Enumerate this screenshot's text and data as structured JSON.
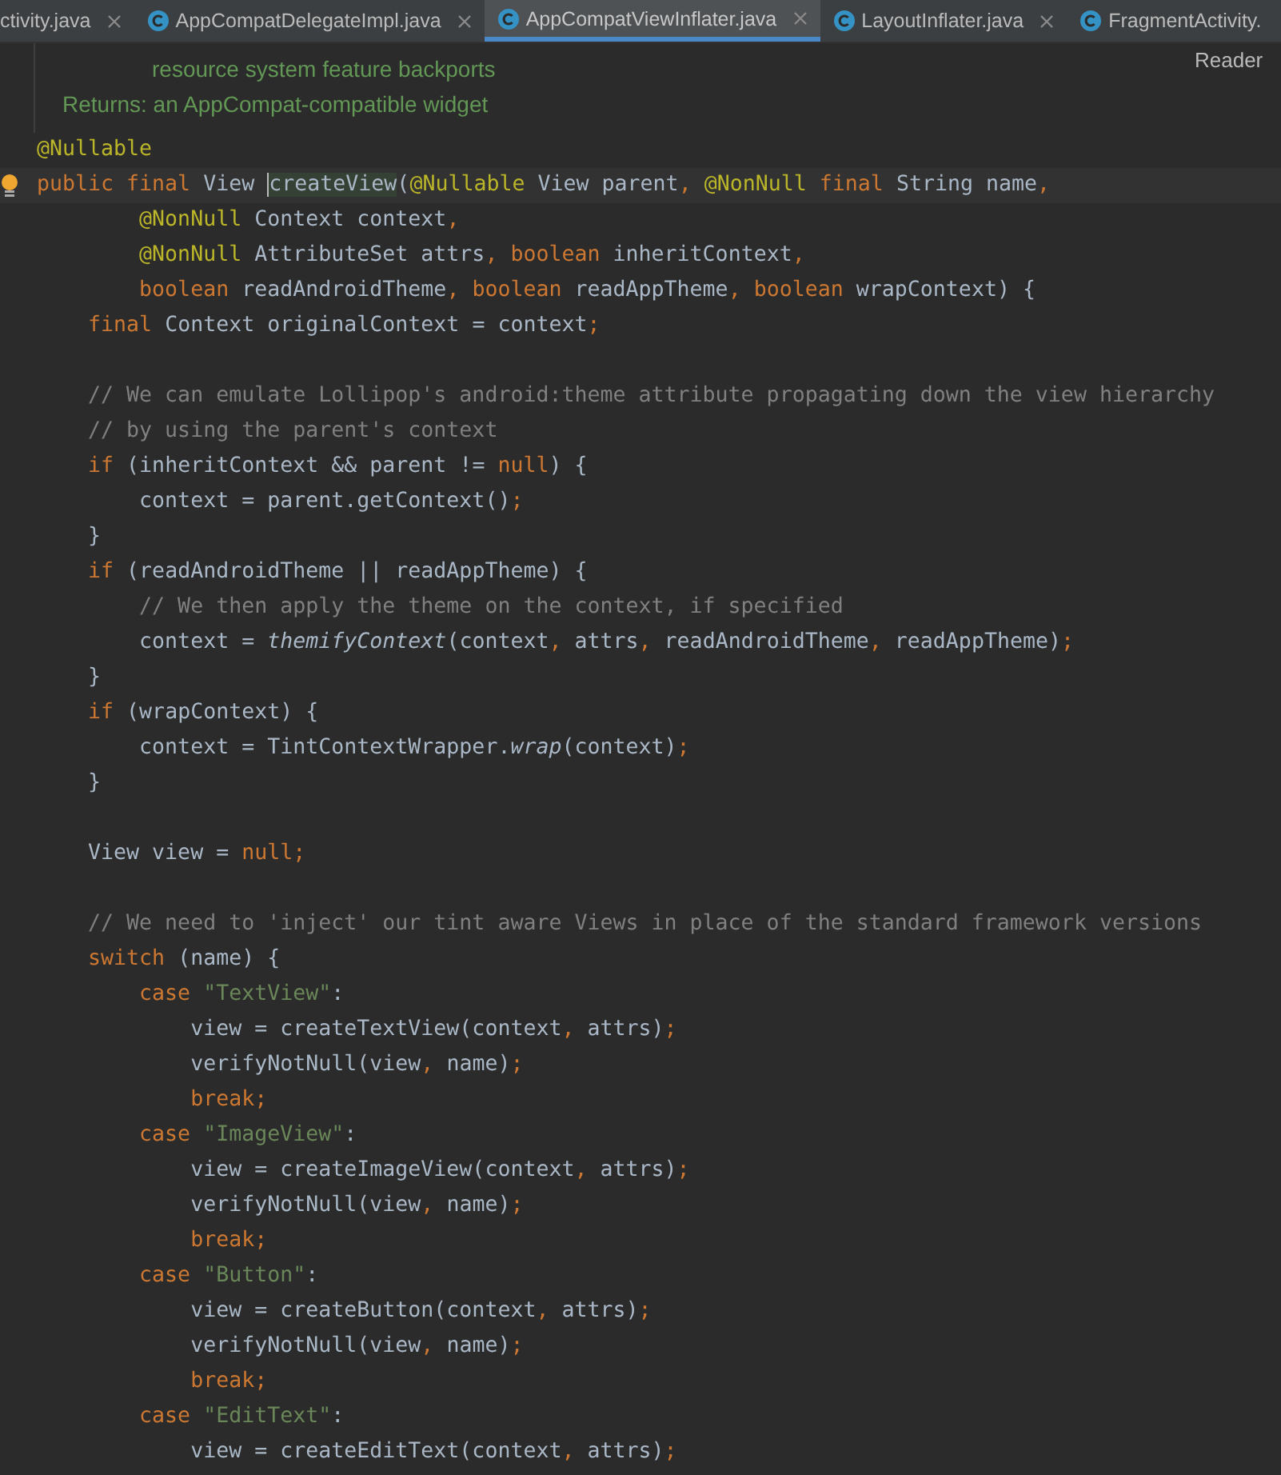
{
  "tabs": [
    {
      "label": "ctivity.java",
      "icon": false,
      "selected": false
    },
    {
      "label": "AppCompatDelegateImpl.java",
      "icon": true,
      "selected": false
    },
    {
      "label": "AppCompatViewInflater.java",
      "icon": true,
      "selected": true
    },
    {
      "label": "LayoutInflater.java",
      "icon": true,
      "selected": false
    },
    {
      "label": "FragmentActivity.",
      "icon": true,
      "selected": false
    }
  ],
  "doc": {
    "lines": [
      "resource system feature backports"
    ],
    "returns": "Returns: an AppCompat-compatible widget",
    "reader_mode": "Reader"
  },
  "code": [
    {
      "kind": "code",
      "tokens": [
        {
          "kind": "ann",
          "text": "@Nullable"
        }
      ]
    },
    {
      "kind": "code",
      "current": true,
      "bulb": true,
      "tokens": [
        {
          "kind": "kw",
          "text": "public final "
        },
        {
          "kind": "id",
          "text": "View "
        },
        {
          "kind": "hl",
          "text": "createView"
        },
        {
          "kind": "id",
          "text": "("
        },
        {
          "kind": "ann",
          "text": "@Nullable "
        },
        {
          "kind": "id",
          "text": "View parent"
        },
        {
          "kind": "kw",
          "text": ", "
        },
        {
          "kind": "ann",
          "text": "@NonNull "
        },
        {
          "kind": "kw",
          "text": "final "
        },
        {
          "kind": "id",
          "text": "String name"
        },
        {
          "kind": "kw",
          "text": ","
        }
      ]
    },
    {
      "kind": "code",
      "tokens": [
        {
          "kind": "ann",
          "text": "        @NonNull "
        },
        {
          "kind": "id",
          "text": "Context context"
        },
        {
          "kind": "kw",
          "text": ","
        }
      ]
    },
    {
      "kind": "code",
      "tokens": [
        {
          "kind": "ann",
          "text": "        @NonNull "
        },
        {
          "kind": "id",
          "text": "AttributeSet attrs"
        },
        {
          "kind": "kw",
          "text": ", boolean "
        },
        {
          "kind": "id",
          "text": "inheritContext"
        },
        {
          "kind": "kw",
          "text": ","
        }
      ]
    },
    {
      "kind": "code",
      "tokens": [
        {
          "kind": "kw",
          "text": "        boolean "
        },
        {
          "kind": "id",
          "text": "readAndroidTheme"
        },
        {
          "kind": "kw",
          "text": ", boolean "
        },
        {
          "kind": "id",
          "text": "readAppTheme"
        },
        {
          "kind": "kw",
          "text": ", boolean "
        },
        {
          "kind": "id",
          "text": "wrapContext) {"
        }
      ]
    },
    {
      "kind": "code",
      "tokens": [
        {
          "kind": "kw",
          "text": "    final "
        },
        {
          "kind": "id",
          "text": "Context originalContext = context"
        },
        {
          "kind": "kw",
          "text": ";"
        }
      ]
    },
    {
      "kind": "blank"
    },
    {
      "kind": "code",
      "tokens": [
        {
          "kind": "cm",
          "text": "    // We can emulate Lollipop's android:theme attribute propagating down the view hierarchy"
        }
      ]
    },
    {
      "kind": "code",
      "tokens": [
        {
          "kind": "cm",
          "text": "    // by using the parent's context"
        }
      ]
    },
    {
      "kind": "code",
      "tokens": [
        {
          "kind": "kw",
          "text": "    if "
        },
        {
          "kind": "id",
          "text": "(inheritContext && parent != "
        },
        {
          "kind": "kw",
          "text": "null"
        },
        {
          "kind": "id",
          "text": ") {"
        }
      ]
    },
    {
      "kind": "code",
      "tokens": [
        {
          "kind": "id",
          "text": "        context = parent.getContext()"
        },
        {
          "kind": "kw",
          "text": ";"
        }
      ]
    },
    {
      "kind": "code",
      "tokens": [
        {
          "kind": "id",
          "text": "    }"
        }
      ]
    },
    {
      "kind": "code",
      "tokens": [
        {
          "kind": "kw",
          "text": "    if "
        },
        {
          "kind": "id",
          "text": "(readAndroidTheme || readAppTheme) {"
        }
      ]
    },
    {
      "kind": "code",
      "tokens": [
        {
          "kind": "cm",
          "text": "        // We then apply the theme on the context, if specified"
        }
      ]
    },
    {
      "kind": "code",
      "tokens": [
        {
          "kind": "id",
          "text": "        context = "
        },
        {
          "kind": "it",
          "text": "themifyContext"
        },
        {
          "kind": "id",
          "text": "(context"
        },
        {
          "kind": "kw",
          "text": ", "
        },
        {
          "kind": "id",
          "text": "attrs"
        },
        {
          "kind": "kw",
          "text": ", "
        },
        {
          "kind": "id",
          "text": "readAndroidTheme"
        },
        {
          "kind": "kw",
          "text": ", "
        },
        {
          "kind": "id",
          "text": "readAppTheme)"
        },
        {
          "kind": "kw",
          "text": ";"
        }
      ]
    },
    {
      "kind": "code",
      "tokens": [
        {
          "kind": "id",
          "text": "    }"
        }
      ]
    },
    {
      "kind": "code",
      "tokens": [
        {
          "kind": "kw",
          "text": "    if "
        },
        {
          "kind": "id",
          "text": "(wrapContext) {"
        }
      ]
    },
    {
      "kind": "code",
      "tokens": [
        {
          "kind": "id",
          "text": "        context = TintContextWrapper."
        },
        {
          "kind": "it",
          "text": "wrap"
        },
        {
          "kind": "id",
          "text": "(context)"
        },
        {
          "kind": "kw",
          "text": ";"
        }
      ]
    },
    {
      "kind": "code",
      "tokens": [
        {
          "kind": "id",
          "text": "    }"
        }
      ]
    },
    {
      "kind": "blank"
    },
    {
      "kind": "code",
      "tokens": [
        {
          "kind": "id",
          "text": "    View view = "
        },
        {
          "kind": "kw",
          "text": "null;"
        }
      ]
    },
    {
      "kind": "blank"
    },
    {
      "kind": "code",
      "tokens": [
        {
          "kind": "cm",
          "text": "    // We need to 'inject' our tint aware Views in place of the standard framework versions"
        }
      ]
    },
    {
      "kind": "code",
      "tokens": [
        {
          "kind": "kw",
          "text": "    switch "
        },
        {
          "kind": "id",
          "text": "(name) {"
        }
      ]
    },
    {
      "kind": "code",
      "tokens": [
        {
          "kind": "kw",
          "text": "        case "
        },
        {
          "kind": "str",
          "text": "\"TextView\""
        },
        {
          "kind": "id",
          "text": ":"
        }
      ]
    },
    {
      "kind": "code",
      "tokens": [
        {
          "kind": "id",
          "text": "            view = createTextView(context"
        },
        {
          "kind": "kw",
          "text": ", "
        },
        {
          "kind": "id",
          "text": "attrs)"
        },
        {
          "kind": "kw",
          "text": ";"
        }
      ]
    },
    {
      "kind": "code",
      "tokens": [
        {
          "kind": "id",
          "text": "            verifyNotNull(view"
        },
        {
          "kind": "kw",
          "text": ", "
        },
        {
          "kind": "id",
          "text": "name)"
        },
        {
          "kind": "kw",
          "text": ";"
        }
      ]
    },
    {
      "kind": "code",
      "tokens": [
        {
          "kind": "kw",
          "text": "            break;"
        }
      ]
    },
    {
      "kind": "code",
      "tokens": [
        {
          "kind": "kw",
          "text": "        case "
        },
        {
          "kind": "str",
          "text": "\"ImageView\""
        },
        {
          "kind": "id",
          "text": ":"
        }
      ]
    },
    {
      "kind": "code",
      "tokens": [
        {
          "kind": "id",
          "text": "            view = createImageView(context"
        },
        {
          "kind": "kw",
          "text": ", "
        },
        {
          "kind": "id",
          "text": "attrs)"
        },
        {
          "kind": "kw",
          "text": ";"
        }
      ]
    },
    {
      "kind": "code",
      "tokens": [
        {
          "kind": "id",
          "text": "            verifyNotNull(view"
        },
        {
          "kind": "kw",
          "text": ", "
        },
        {
          "kind": "id",
          "text": "name)"
        },
        {
          "kind": "kw",
          "text": ";"
        }
      ]
    },
    {
      "kind": "code",
      "tokens": [
        {
          "kind": "kw",
          "text": "            break;"
        }
      ]
    },
    {
      "kind": "code",
      "tokens": [
        {
          "kind": "kw",
          "text": "        case "
        },
        {
          "kind": "str",
          "text": "\"Button\""
        },
        {
          "kind": "id",
          "text": ":"
        }
      ]
    },
    {
      "kind": "code",
      "tokens": [
        {
          "kind": "id",
          "text": "            view = createButton(context"
        },
        {
          "kind": "kw",
          "text": ", "
        },
        {
          "kind": "id",
          "text": "attrs)"
        },
        {
          "kind": "kw",
          "text": ";"
        }
      ]
    },
    {
      "kind": "code",
      "tokens": [
        {
          "kind": "id",
          "text": "            verifyNotNull(view"
        },
        {
          "kind": "kw",
          "text": ", "
        },
        {
          "kind": "id",
          "text": "name)"
        },
        {
          "kind": "kw",
          "text": ";"
        }
      ]
    },
    {
      "kind": "code",
      "tokens": [
        {
          "kind": "kw",
          "text": "            break;"
        }
      ]
    },
    {
      "kind": "code",
      "tokens": [
        {
          "kind": "kw",
          "text": "        case "
        },
        {
          "kind": "str",
          "text": "\"EditText\""
        },
        {
          "kind": "id",
          "text": ":"
        }
      ]
    },
    {
      "kind": "code",
      "tokens": [
        {
          "kind": "id",
          "text": "            view = createEditText(context"
        },
        {
          "kind": "kw",
          "text": ", "
        },
        {
          "kind": "id",
          "text": "attrs)"
        },
        {
          "kind": "kw",
          "text": ";"
        }
      ]
    }
  ]
}
